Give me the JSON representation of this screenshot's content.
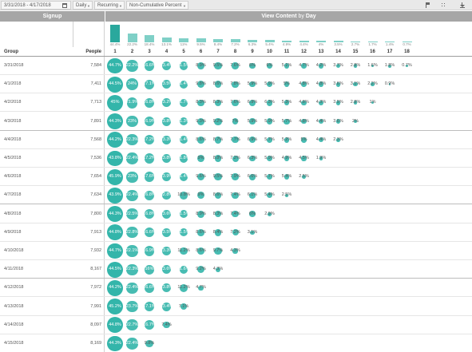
{
  "toolbar": {
    "date_range": "3/31/2018 - 4/17/2018",
    "interval": "Daily",
    "mode": "Recurring",
    "percent_mode": "Non-Cumulative Percent",
    "icons": [
      "calendar-icon",
      "flag-icon",
      "grid-icon",
      "download-icon"
    ]
  },
  "header": {
    "left_title": "Signup",
    "right_title_a": "View Content",
    "right_title_b": "by",
    "right_title_c": "Day"
  },
  "columns": {
    "group": "Group",
    "people": "People",
    "days": [
      "1",
      "2",
      "3",
      "4",
      "5",
      "6",
      "7",
      "8",
      "9",
      "10",
      "11",
      "12",
      "13",
      "14",
      "15",
      "16",
      "17",
      "18"
    ]
  },
  "summary": [
    "44.4%",
    "22.2%",
    "18.4%",
    "13.1%",
    "11%",
    "9.5%",
    "8.4%",
    "7.2%",
    "6.3%",
    "5.4%",
    "4.9%",
    "4.4%",
    "4%",
    "3.5%",
    "2.7%",
    "1.7%",
    "1.4%",
    "0.7%"
  ],
  "colors": {
    "accent": "#33b5aa",
    "header": "#a6a6a6",
    "toolbar": "#e9e9e9"
  },
  "rows": [
    {
      "date": "3/31/2018",
      "people": "7,584",
      "values": [
        "44.7%",
        "22.2%",
        "16.6%",
        "13.4%",
        "11.5%",
        "8.9%",
        "9.5%",
        "7.6%",
        "6%",
        "6%",
        "5.1%",
        "4.7%",
        "4.2%",
        "3.7%",
        "2.8%",
        "1.6%",
        "1.8%",
        "0.7%"
      ]
    },
    {
      "date": "4/1/2018",
      "people": "7,411",
      "values": [
        "44.5%",
        "24%",
        "17.1%",
        "13.5%",
        "11.4%",
        "9.8%",
        "8.6%",
        "7.8%",
        "5.9%",
        "5.9%",
        "5%",
        "4.8%",
        "4.8%",
        "3.6%",
        "3.1%",
        "2.2%",
        "0.9%"
      ]
    },
    {
      "date": "4/2/2018",
      "people": "7,713",
      "values": [
        "45%",
        "21.9%",
        "16.8%",
        "13.2%",
        "11.7%",
        "8.3%",
        "8.3%",
        "7.6%",
        "6.9%",
        "6.3%",
        "5.3%",
        "4.8%",
        "4.3%",
        "3.9%",
        "2.8%",
        "1%"
      ]
    },
    {
      "date": "4/3/2018",
      "people": "7,891",
      "values": [
        "44.3%",
        "23%",
        "16.9%",
        "13.8%",
        "11.3%",
        "9.3%",
        "9.2%",
        "7%",
        "5.9%",
        "5.9%",
        "5.7%",
        "4.8%",
        "4.4%",
        "3.6%",
        "2%"
      ]
    },
    {
      "date": "4/4/2018",
      "people": "7,568",
      "values": [
        "44.2%",
        "22.3%",
        "17.2%",
        "13.3%",
        "11.4%",
        "8.6%",
        "8.7%",
        "7.7%",
        "6.9%",
        "5.7%",
        "5.2%",
        "5%",
        "4.4%",
        "2.3%"
      ]
    },
    {
      "date": "4/5/2018",
      "people": "7,536",
      "values": [
        "43.8%",
        "22.4%",
        "17.2%",
        "13.8%",
        "11.8%",
        "9%",
        "8.8%",
        "7.2%",
        "6.3%",
        "5.9%",
        "4.9%",
        "4.5%",
        "1.9%"
      ]
    },
    {
      "date": "4/6/2018",
      "people": "7,654",
      "values": [
        "45.9%",
        "23%",
        "17.6%",
        "13.9%",
        "11.4%",
        "9.6%",
        "9.5%",
        "7.9%",
        "6.6%",
        "5.7%",
        "5.4%",
        "2.5%"
      ]
    },
    {
      "date": "4/7/2018",
      "people": "7,634",
      "values": [
        "43.9%",
        "22.4%",
        "16.8%",
        "12.8%",
        "10.8%",
        "9%",
        "8.6%",
        "7.4%",
        "6.1%",
        "5.4%",
        "2.5%"
      ]
    },
    {
      "date": "4/8/2018",
      "people": "7,800",
      "values": [
        "44.3%",
        "22.5%",
        "16.8%",
        "13.6%",
        "11.5%",
        "8.9%",
        "8.3%",
        "7.4%",
        "6%",
        "2.9%"
      ]
    },
    {
      "date": "4/9/2018",
      "people": "7,913",
      "values": [
        "44.8%",
        "22.8%",
        "16.6%",
        "13.5%",
        "11.5%",
        "8.6%",
        "8.4%",
        "7.2%",
        "3.1%"
      ]
    },
    {
      "date": "4/10/2018",
      "people": "7,932",
      "values": [
        "44.7%",
        "22.1%",
        "16.9%",
        "13.3%",
        "11.2%",
        "8.6%",
        "9.7%",
        "4.3%"
      ]
    },
    {
      "date": "4/11/2018",
      "people": "8,167",
      "values": [
        "44.5%",
        "22.3%",
        "16%",
        "13.6%",
        "11.6%",
        "9.2%",
        "4.3%"
      ]
    },
    {
      "date": "4/12/2018",
      "people": "7,972",
      "values": [
        "44.2%",
        "22.4%",
        "16.6%",
        "13.8%",
        "11.2%",
        "4.7%"
      ]
    },
    {
      "date": "4/13/2018",
      "people": "7,991",
      "values": [
        "45.2%",
        "23.7%",
        "17.1%",
        "13.4%",
        "7.1%"
      ]
    },
    {
      "date": "4/14/2018",
      "people": "8,097",
      "values": [
        "44.8%",
        "22.7%",
        "16.7%",
        "7.4%"
      ]
    },
    {
      "date": "4/15/2018",
      "people": "8,169",
      "values": [
        "44.3%",
        "22.4%",
        "9.8%"
      ]
    }
  ]
}
